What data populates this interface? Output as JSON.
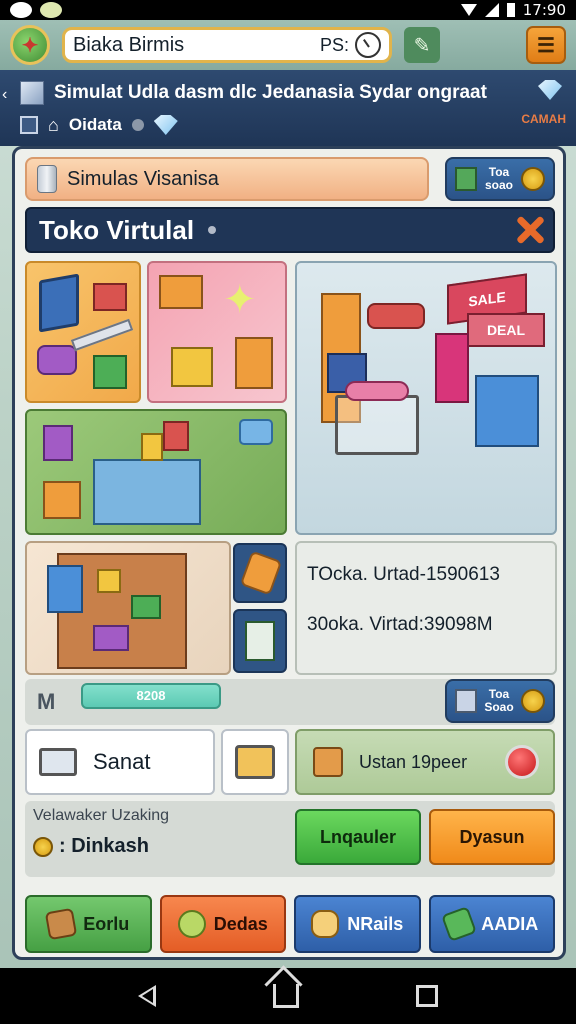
{
  "status_bar": {
    "time": "17:90"
  },
  "top_bar": {
    "search_value": "Biaka Birmis",
    "search_suffix": "PS:"
  },
  "header": {
    "headline": "Simulat Udla  dasm dlc Jedanasia Sydar ongraat",
    "subline": "Oidata",
    "side_label": "CAMAH"
  },
  "panel": {
    "sim_tab": "Simulas Visanisa",
    "coin_badge_line1": "Toa",
    "coin_badge_line2": "soao",
    "title": "Toko Virtulal",
    "info_line1": "TOcka. Urtad-1590613",
    "info_line2": "30oka. Virtad:39098M",
    "filter_label": "M",
    "filter_pill": "8208",
    "coin_badge2_line1": "Toa",
    "coin_badge2_line2": "Soao",
    "sanat_label": "Sanat",
    "upgrade_label": "Ustan 19peer",
    "balance_label": "Velawaker Uzaking",
    "balance_value": ": Dinkash",
    "btn_green": "Lnqauler",
    "btn_orange": "Dyasun"
  },
  "nav_tabs": [
    {
      "label": "Eorlu",
      "icon": "wallet-icon",
      "color": "green"
    },
    {
      "label": "Dedas",
      "icon": "leaf-icon",
      "color": "orange"
    },
    {
      "label": "NRails",
      "icon": "hand-icon",
      "color": "blue"
    },
    {
      "label": "AADIA",
      "icon": "cash-icon",
      "color": "blue"
    }
  ],
  "colors": {
    "accent_orange": "#f08a1a",
    "accent_green": "#3aa93a",
    "header_navy": "#1f3556",
    "panel_bg": "#eef0ec"
  }
}
